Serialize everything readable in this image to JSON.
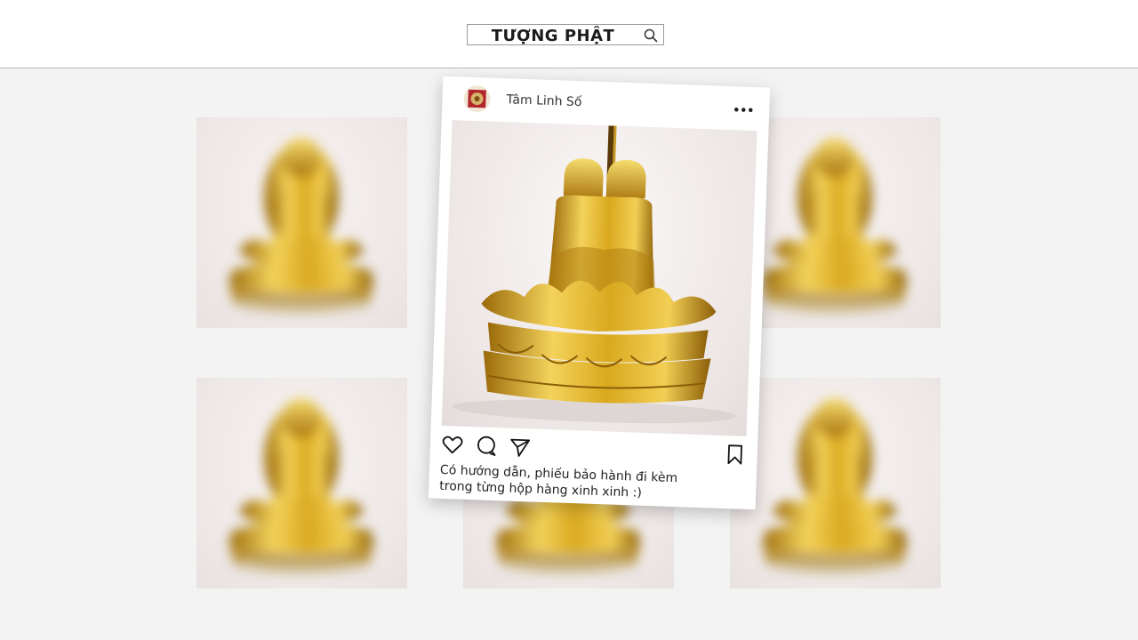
{
  "search": {
    "query": "TƯỢNG PHẬT"
  },
  "post": {
    "username": "Tâm Linh Số",
    "caption_line1": "Có hướng dẫn, phiếu bảo hành đi kèm",
    "caption_line2": "trong từng hộp hàng xinh xinh :)"
  },
  "icons": {
    "search": "search-icon",
    "menu": "more-dots-icon",
    "like": "heart-icon",
    "comment": "comment-icon",
    "share": "send-icon",
    "save": "bookmark-icon"
  },
  "colors": {
    "gold": "#d9a81e",
    "gold_light": "#f4d35c",
    "gold_dark": "#9a6a0a"
  }
}
